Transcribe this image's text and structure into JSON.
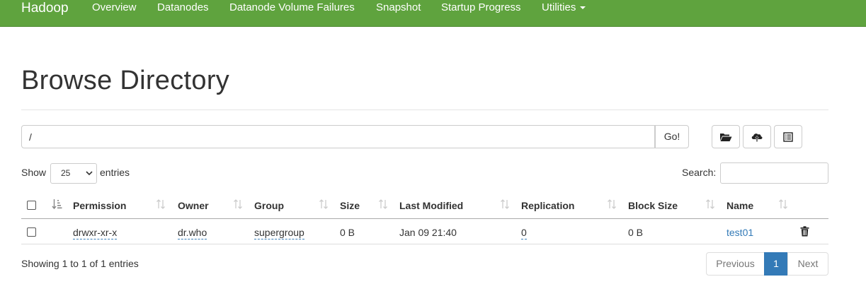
{
  "navbar": {
    "brand": "Hadoop",
    "items": [
      "Overview",
      "Datanodes",
      "Datanode Volume Failures",
      "Snapshot",
      "Startup Progress",
      "Utilities"
    ],
    "color": "#5fa33e"
  },
  "page": {
    "title": "Browse Directory"
  },
  "path_bar": {
    "value": "/",
    "go_label": "Go!"
  },
  "toolbar": {
    "icons": [
      "folder-open-icon",
      "cloud-upload-icon",
      "list-alt-icon"
    ]
  },
  "table_controls": {
    "show_label": "Show",
    "page_length": "25",
    "entries_label": "entries",
    "search_label": "Search:"
  },
  "table": {
    "columns": [
      "Permission",
      "Owner",
      "Group",
      "Size",
      "Last Modified",
      "Replication",
      "Block Size",
      "Name"
    ],
    "rows": [
      {
        "permission": "drwxr-xr-x",
        "owner": "dr.who",
        "group": "supergroup",
        "size": "0 B",
        "last_modified": "Jan 09 21:40",
        "replication": "0",
        "block_size": "0 B",
        "name": "test01"
      }
    ]
  },
  "footer": {
    "info": "Showing 1 to 1 of 1 entries",
    "previous": "Previous",
    "current_page": "1",
    "next": "Next"
  },
  "colors": {
    "link": "#337ab7",
    "active_page": "#337ab7"
  }
}
